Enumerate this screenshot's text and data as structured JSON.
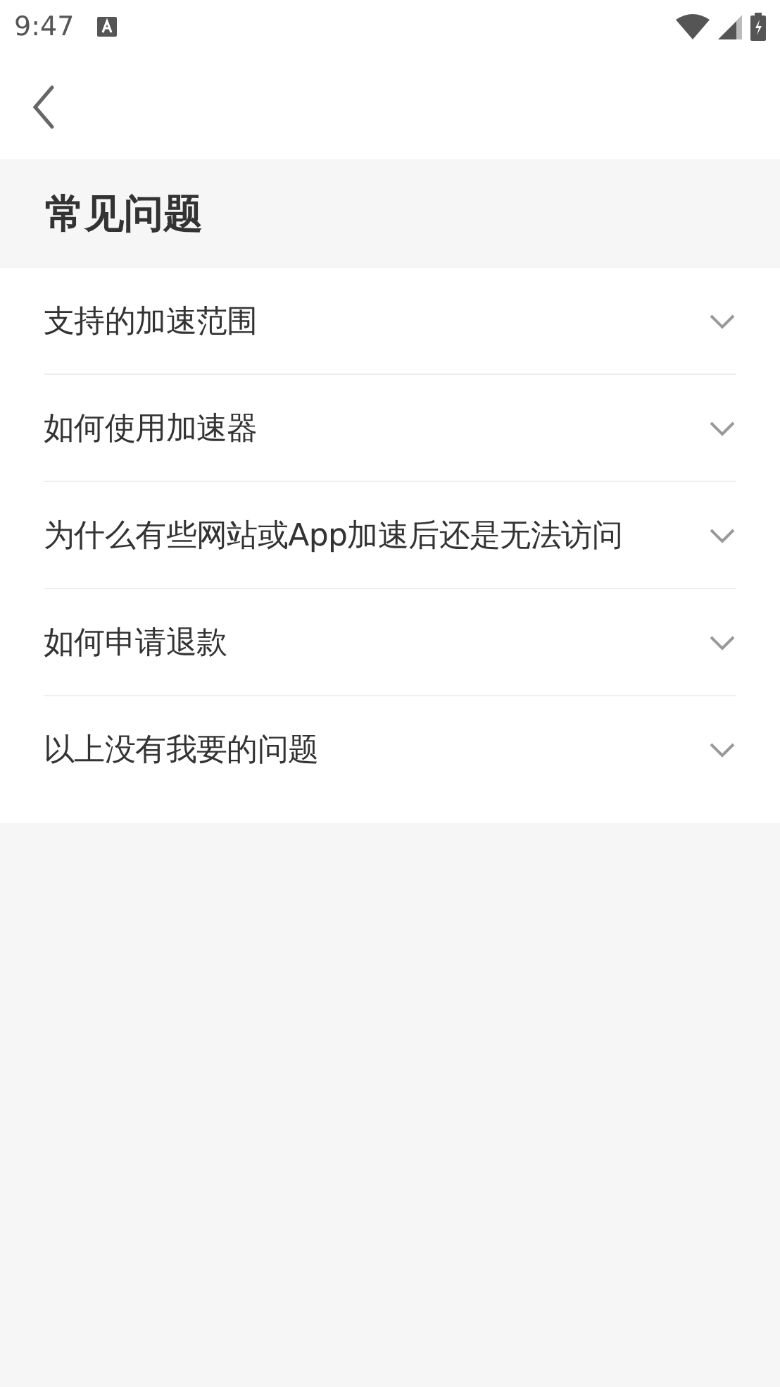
{
  "status_bar": {
    "time": "9:47"
  },
  "header": {
    "title": "常见问题"
  },
  "faq": [
    {
      "question": "支持的加速范围",
      "expanded": false
    },
    {
      "question": "如何使用加速器",
      "expanded": false
    },
    {
      "question": "为什么有些网站或App加速后还是无法访问",
      "expanded": false
    },
    {
      "question": "如何申请退款",
      "expanded": false
    },
    {
      "question": "以上没有我要的问题",
      "expanded": false
    }
  ]
}
